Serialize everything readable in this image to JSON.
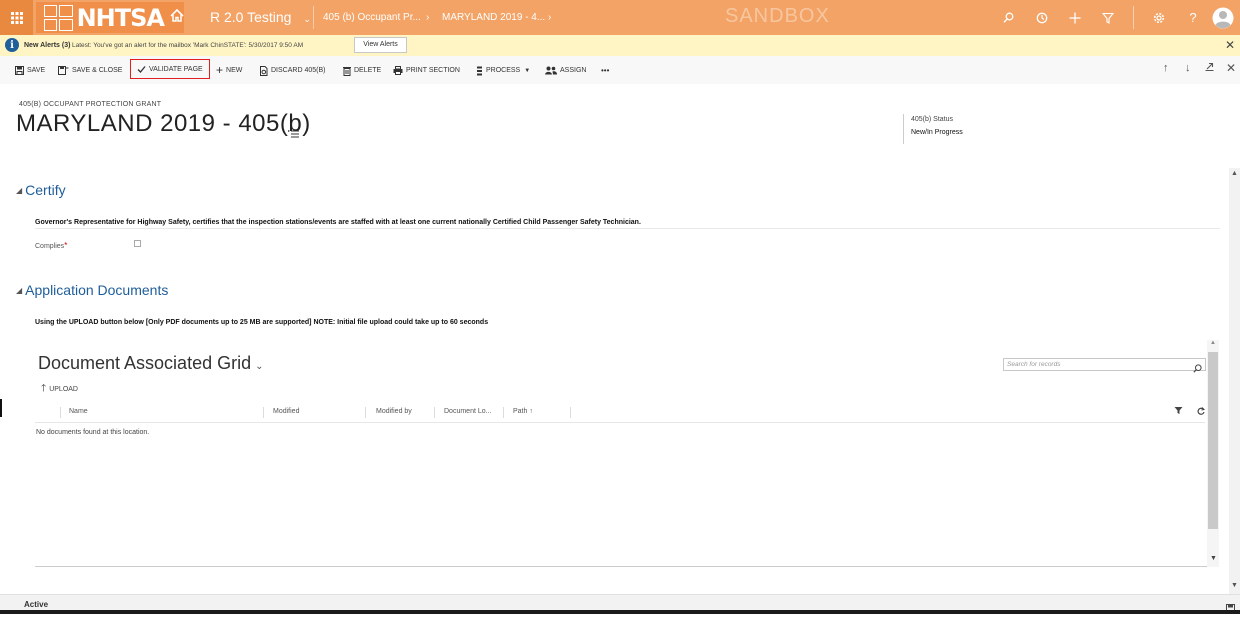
{
  "nav": {
    "logo_text": "NHTSA",
    "app_name": "R 2.0 Testing",
    "breadcrumb_entity": "405 (b) Occupant Pr...",
    "breadcrumb_record": "MARYLAND 2019 - 4...",
    "environment": "SANDBOX",
    "icons": [
      "waffle-icon",
      "home-icon",
      "search-icon",
      "history-icon",
      "plus-icon",
      "filter-icon",
      "gear-icon",
      "help-icon",
      "user-avatar-icon"
    ],
    "brand_color": "#f3a365"
  },
  "alert": {
    "count_label": "New Alerts (3)",
    "message": "Latest: You've got an alert for the mailbox 'Mark ChinSTATE': 5/30/2017 9:50 AM",
    "view_button": "View Alerts"
  },
  "commands": {
    "save": "SAVE",
    "save_close": "SAVE & CLOSE",
    "validate": "VALIDATE PAGE",
    "new": "NEW",
    "discard": "DISCARD 405(B)",
    "delete": "DELETE",
    "print": "PRINT SECTION",
    "process": "PROCESS",
    "assign": "ASSIGN",
    "more": "•••"
  },
  "header": {
    "entity_type": "405(B) OCCUPANT PROTECTION GRANT",
    "title": "MARYLAND 2019 - 405(b)",
    "status_label": "405(b) Status",
    "status_value": "New/In Progress"
  },
  "certify": {
    "title": "Certify",
    "statement": "Governor's Representative for Highway Safety, certifies that the inspection stations/events are staffed with at least one current nationally Certified Child Passenger Safety Technician.",
    "complies_label": "Complies",
    "required_mark": "*"
  },
  "documents": {
    "title": "Application Documents",
    "instruction": "Using the UPLOAD button below [Only PDF documents up to 25 MB are supported] NOTE: Initial file upload could take up to 60 seconds",
    "grid_title": "Document Associated Grid",
    "search_placeholder": "Search for records",
    "upload_label": "UPLOAD",
    "columns": [
      "Name",
      "Modified",
      "Modified by",
      "Document Lo...",
      "Path ↑"
    ],
    "empty_message": "No documents found at this location."
  },
  "footer": {
    "status": "Active"
  }
}
